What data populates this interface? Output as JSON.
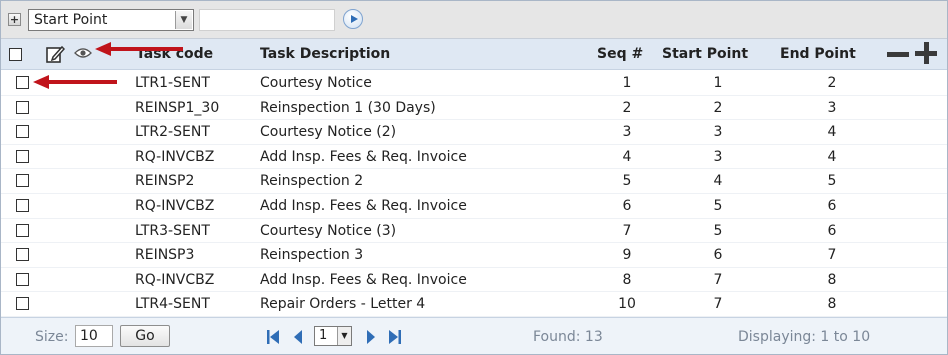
{
  "toolbar": {
    "filter_field": "Start Point",
    "search_value": ""
  },
  "header": {
    "task_code": "Task code",
    "task_description": "Task Description",
    "seq": "Seq #",
    "start_point": "Start Point",
    "end_point": "End Point"
  },
  "rows": [
    {
      "code": "LTR1-SENT",
      "desc": "Courtesy Notice",
      "seq": "1",
      "start": "1",
      "end": "2"
    },
    {
      "code": "REINSP1_30",
      "desc": "Reinspection 1 (30 Days)",
      "seq": "2",
      "start": "2",
      "end": "3"
    },
    {
      "code": "LTR2-SENT",
      "desc": "Courtesy Notice (2)",
      "seq": "3",
      "start": "3",
      "end": "4"
    },
    {
      "code": "RQ-INVCBZ",
      "desc": "Add Insp. Fees & Req. Invoice",
      "seq": "4",
      "start": "3",
      "end": "4"
    },
    {
      "code": "REINSP2",
      "desc": "Reinspection 2",
      "seq": "5",
      "start": "4",
      "end": "5"
    },
    {
      "code": "RQ-INVCBZ",
      "desc": "Add Insp. Fees & Req. Invoice",
      "seq": "6",
      "start": "5",
      "end": "6"
    },
    {
      "code": "LTR3-SENT",
      "desc": "Courtesy Notice (3)",
      "seq": "7",
      "start": "5",
      "end": "6"
    },
    {
      "code": "REINSP3",
      "desc": "Reinspection 3",
      "seq": "9",
      "start": "6",
      "end": "7"
    },
    {
      "code": "RQ-INVCBZ",
      "desc": "Add Insp. Fees & Req. Invoice",
      "seq": "8",
      "start": "7",
      "end": "8"
    },
    {
      "code": "LTR4-SENT",
      "desc": "Repair Orders - Letter 4",
      "seq": "10",
      "start": "7",
      "end": "8"
    }
  ],
  "footer": {
    "size_label": "Size:",
    "size_value": "10",
    "go_label": "Go",
    "page_value": "1",
    "found": "Found: 13",
    "displaying": "Displaying: 1 to 10"
  },
  "colors": {
    "annotation_arrow": "#c0141b",
    "header_bg": "#dfe8f3",
    "nav_blue": "#2f6db6"
  }
}
